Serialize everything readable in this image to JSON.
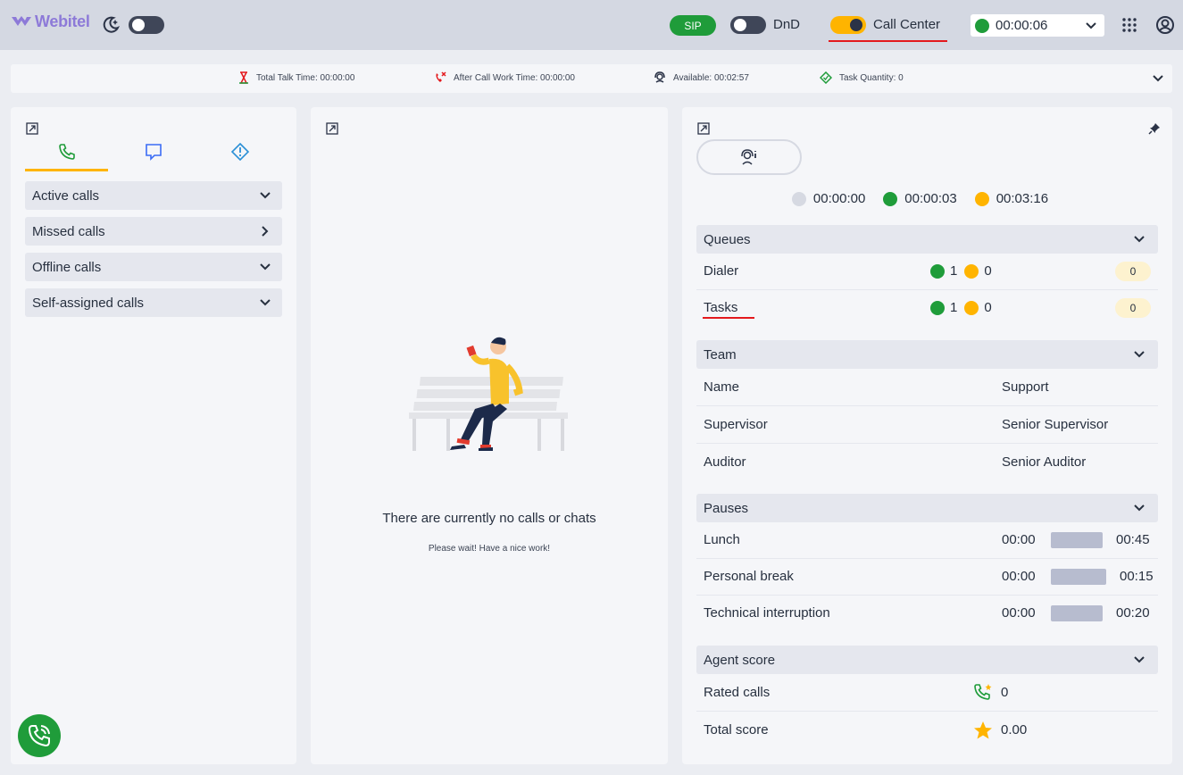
{
  "header": {
    "logo_text": "Webitel",
    "sip_label": "SIP",
    "dnd_label": "DnD",
    "call_center_label": "Call Center",
    "status_time": "00:00:06",
    "status_color": "#1f9c3a",
    "accent_color": "#ffb400",
    "icons": [
      "webitel-logo-icon",
      "theme-moon-icon",
      "apps-grid-icon",
      "user-account-icon",
      "chevron-down-icon"
    ]
  },
  "infobar": {
    "total_talk": "Total Talk Time: 00:00:00",
    "after_call": "After Call Work Time: 00:00:00",
    "available": "Available: 00:02:57",
    "task_quantity": "Task Quantity: 0"
  },
  "left": {
    "tabs": [
      "phone-tab",
      "chat-tab",
      "alert-tab"
    ],
    "sections": [
      {
        "label": "Active calls",
        "icon": "chevron-down-icon"
      },
      {
        "label": "Missed calls",
        "icon": "chevron-right-icon"
      },
      {
        "label": "Offline calls",
        "icon": "chevron-down-icon"
      },
      {
        "label": "Self-assigned calls",
        "icon": "chevron-down-icon"
      }
    ]
  },
  "middle": {
    "empty_title": "There are currently no calls or chats",
    "empty_subtitle": "Please wait! Have a nice work!"
  },
  "right": {
    "timers": [
      {
        "time": "00:00:00",
        "color": "#d6d9e2"
      },
      {
        "time": "00:00:03",
        "color": "#1f9c3a"
      },
      {
        "time": "00:03:16",
        "color": "#ffb400"
      }
    ],
    "queues": {
      "title": "Queues",
      "rows": [
        {
          "name": "Dialer",
          "green": "1",
          "yellow": "0",
          "badge": "0"
        },
        {
          "name": "Tasks",
          "green": "1",
          "yellow": "0",
          "badge": "0"
        }
      ]
    },
    "team": {
      "title": "Team",
      "rows": [
        {
          "label": "Name",
          "value": "Support"
        },
        {
          "label": "Supervisor",
          "value": "Senior Supervisor"
        },
        {
          "label": "Auditor",
          "value": "Senior Auditor"
        }
      ]
    },
    "pauses": {
      "title": "Pauses",
      "rows": [
        {
          "name": "Lunch",
          "start": "00:00",
          "end": "00:45"
        },
        {
          "name": "Personal break",
          "start": "00:00",
          "end": "00:15"
        },
        {
          "name": "Technical interruption",
          "start": "00:00",
          "end": "00:20"
        }
      ]
    },
    "score": {
      "title": "Agent score",
      "rated_label": "Rated calls",
      "rated_value": "0",
      "total_label": "Total score",
      "total_value": "0.00"
    }
  }
}
